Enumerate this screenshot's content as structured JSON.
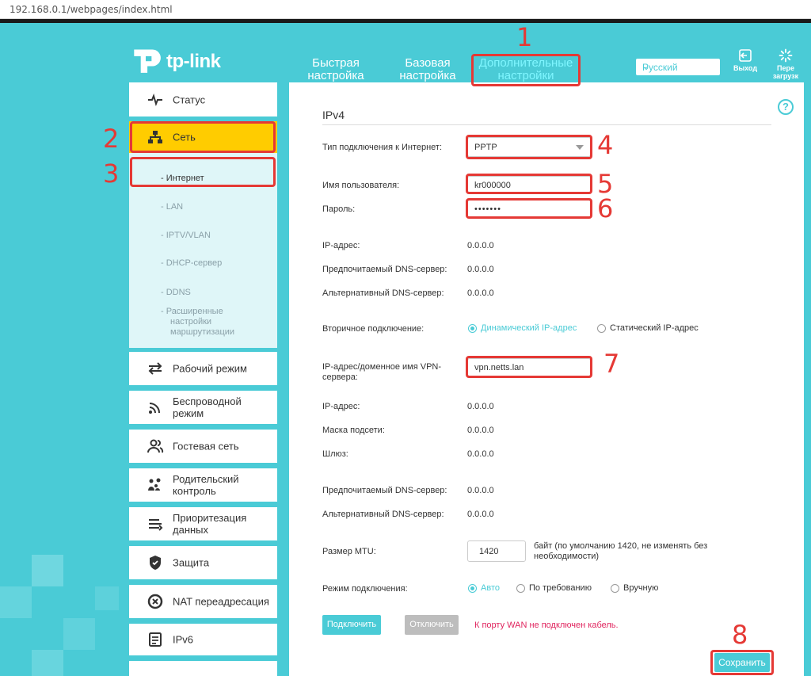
{
  "browser": {
    "url": "192.168.0.1/webpages/index.html"
  },
  "brand": {
    "logo_text": "tp-link",
    "accent": "#4acbd6",
    "active_nav": "#ffcc00",
    "annotation": "#e53935"
  },
  "nav": {
    "quick_line1": "Быстрая",
    "quick_line2": "настройка",
    "basic_line1": "Базовая",
    "basic_line2": "настройка",
    "advanced_line1": "Дополнительные",
    "advanced_line2": "настройки"
  },
  "header": {
    "language": "Русский",
    "logout_label": "Выход",
    "reboot_line1": "Пере",
    "reboot_line2": "загрузк"
  },
  "sidebar": {
    "status": "Статус",
    "network": "Сеть",
    "sub": {
      "internet": "- Интернет",
      "lan": "- LAN",
      "iptv": "- IPTV/VLAN",
      "dhcp": "- DHCP-сервер",
      "ddns": "- DDNS",
      "routing_line1": "- Расширенные",
      "routing_line2": "настройки",
      "routing_line3": "маршрутизации"
    },
    "mode": "Рабочий режим",
    "wireless_line1": "Беспроводной",
    "wireless_line2": "режим",
    "guest": "Гостевая сеть",
    "parental_line1": "Родительский",
    "parental_line2": "контроль",
    "qos_line1": "Приоритезация",
    "qos_line2": "данных",
    "security": "Защита",
    "nat": "NAT переадресация",
    "ipv6": "IPv6"
  },
  "form": {
    "section_title": "IPv4",
    "help": "?",
    "conn_type_label": "Тип подключения к Интернет:",
    "conn_type_value": "PPTP",
    "username_label": "Имя пользователя:",
    "username_value": "kr000000",
    "password_label": "Пароль:",
    "password_value": "•••••••",
    "ip_label": "IP-адрес:",
    "ip_value": "0.0.0.0",
    "dns1_label": "Предпочитаемый DNS-сервер:",
    "dns1_value": "0.0.0.0",
    "dns2_label": "Альтернативный DNS-сервер:",
    "dns2_value": "0.0.0.0",
    "secondary_label": "Вторичное подключение:",
    "secondary_dynamic": "Динамический IP-адрес",
    "secondary_static": "Статический IP-адрес",
    "vpn_label_line1": "IP-адрес/доменное имя VPN-",
    "vpn_label_line2": "сервера:",
    "vpn_value": "vpn.netts.lan",
    "ip2_label": "IP-адрес:",
    "ip2_value": "0.0.0.0",
    "mask_label": "Маска подсети:",
    "mask_value": "0.0.0.0",
    "gateway_label": "Шлюз:",
    "gateway_value": "0.0.0.0",
    "dns3_label": "Предпочитаемый DNS-сервер:",
    "dns3_value": "0.0.0.0",
    "dns4_label": "Альтернативный DNS-сервер:",
    "dns4_value": "0.0.0.0",
    "mtu_label": "Размер MTU:",
    "mtu_value": "1420",
    "mtu_hint_line1": "байт (по умолчанию 1420, не изменять без",
    "mtu_hint_line2": "необходимости)",
    "mode_label": "Режим подключения:",
    "mode_auto": "Авто",
    "mode_demand": "По требованию",
    "mode_manual": "Вручную",
    "connect_button": "Подключить",
    "disconnect_button": "Отключить",
    "error_text": "К порту WAN не подключен кабель.",
    "save_button": "Сохранить"
  },
  "annotations": [
    "1",
    "2",
    "3",
    "4",
    "5",
    "6",
    "7",
    "8"
  ]
}
